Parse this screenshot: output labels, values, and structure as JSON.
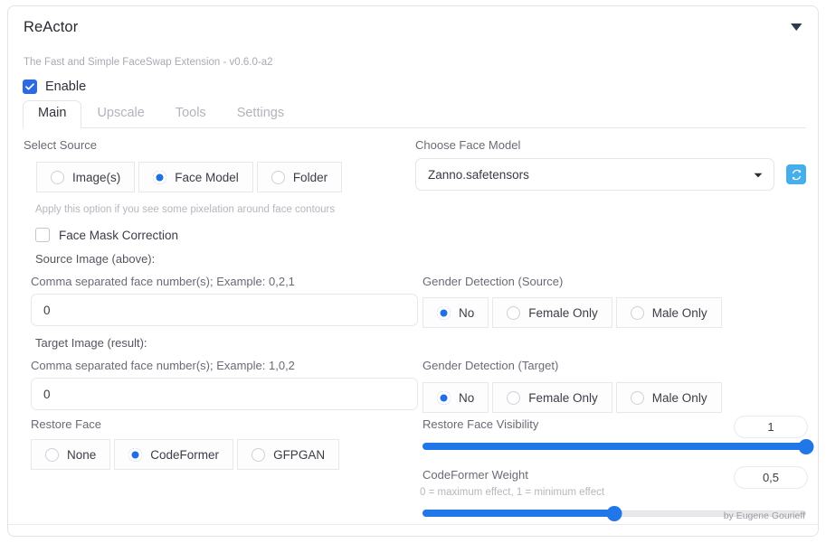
{
  "header": {
    "title": "ReActor",
    "subtitle": "The Fast and Simple FaceSwap Extension - v0.6.0-a2",
    "collapse_icon": "chevron-down-icon",
    "accent_color": "#2176e8"
  },
  "enable": {
    "label": "Enable",
    "checked": true
  },
  "tabs": [
    {
      "label": "Main",
      "active": true
    },
    {
      "label": "Upscale",
      "active": false
    },
    {
      "label": "Tools",
      "active": false
    },
    {
      "label": "Settings",
      "active": false
    }
  ],
  "select_source": {
    "label": "Select Source",
    "options": [
      "Image(s)",
      "Face Model",
      "Folder"
    ],
    "selected": "Face Model"
  },
  "face_mask": {
    "hint": "Apply this option if you see some pixelation around face contours",
    "label": "Face Mask Correction",
    "checked": false
  },
  "face_model": {
    "label": "Choose Face Model",
    "value": "Zanno.safetensors",
    "dropdown_icon": "chevron-down-icon",
    "refresh_icon": "refresh-icon"
  },
  "source_image": {
    "section_label": "Source Image (above):",
    "field_label": "Comma separated face number(s); Example: 0,2,1",
    "value": "0"
  },
  "target_image": {
    "section_label": "Target Image (result):",
    "field_label": "Comma separated face number(s); Example: 1,0,2",
    "value": "0"
  },
  "gender_source": {
    "label": "Gender Detection (Source)",
    "options": [
      "No",
      "Female Only",
      "Male Only"
    ],
    "selected": "No"
  },
  "gender_target": {
    "label": "Gender Detection (Target)",
    "options": [
      "No",
      "Female Only",
      "Male Only"
    ],
    "selected": "No"
  },
  "restore_face": {
    "label": "Restore Face",
    "options": [
      "None",
      "CodeFormer",
      "GFPGAN"
    ],
    "selected": "CodeFormer"
  },
  "visibility_slider": {
    "label": "Restore Face Visibility",
    "value": "1",
    "percent": 100
  },
  "weight_slider": {
    "label": "CodeFormer Weight",
    "hint": "0 = maximum effect, 1 = minimum effect",
    "value": "0,5",
    "percent": 50
  },
  "footer": {
    "credit": "by Eugene Gourieff"
  }
}
